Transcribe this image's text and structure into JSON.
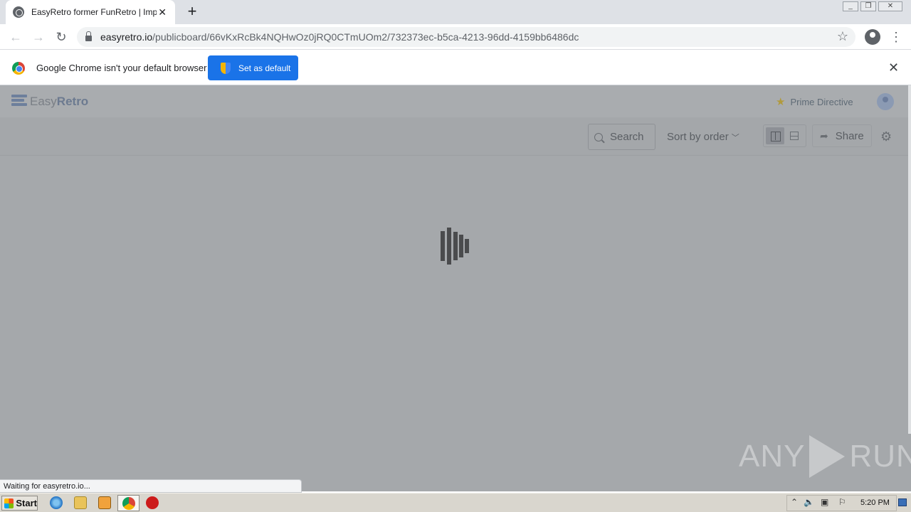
{
  "browser": {
    "tab_title": "EasyRetro former FunRetro | Impro",
    "url_host": "easyretro.io",
    "url_path": "/publicboard/66vKxRcBk4NQHwOz0jRQ0CTmUOm2/732373ec-b5ca-4213-96dd-4159bb6486dc",
    "status_text": "Waiting for easyretro.io..."
  },
  "infobar": {
    "message": "Google Chrome isn't your default browser",
    "button_label": "Set as default"
  },
  "app": {
    "logo_light": "Easy",
    "logo_bold": "Retro",
    "prime_directive": "Prime Directive",
    "search_label": "Search",
    "sort_label": "Sort by order",
    "share_label": "Share"
  },
  "watermark": {
    "left": "ANY",
    "right": "RUN"
  },
  "taskbar": {
    "start_label": "Start",
    "clock": "5:20 PM"
  },
  "colors": {
    "accent": "#1a73e8",
    "overlay": "#a5a8ab",
    "loader": "#4a4b4d"
  }
}
